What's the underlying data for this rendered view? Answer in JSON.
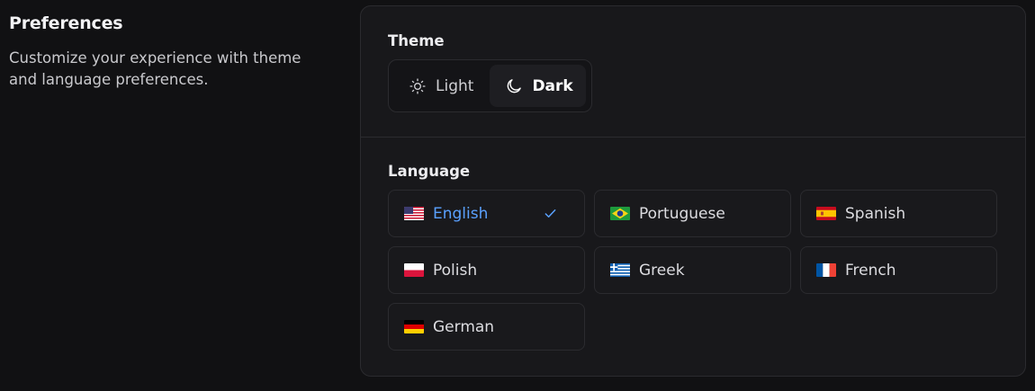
{
  "intro": {
    "title": "Preferences",
    "description": "Customize your experience with theme and language preferences."
  },
  "theme": {
    "label": "Theme",
    "selected": "Dark",
    "options": [
      {
        "label": "Light",
        "icon": "sun-icon"
      },
      {
        "label": "Dark",
        "icon": "moon-icon"
      }
    ]
  },
  "language": {
    "label": "Language",
    "selected": "English",
    "options": [
      {
        "label": "English",
        "flag": "us-flag-icon"
      },
      {
        "label": "Portuguese",
        "flag": "brazil-flag-icon"
      },
      {
        "label": "Spanish",
        "flag": "spain-flag-icon"
      },
      {
        "label": "Polish",
        "flag": "poland-flag-icon"
      },
      {
        "label": "Greek",
        "flag": "greece-flag-icon"
      },
      {
        "label": "French",
        "flag": "france-flag-icon"
      },
      {
        "label": "German",
        "flag": "germany-flag-icon"
      }
    ]
  },
  "colors": {
    "background": "#111113",
    "card": "#18181b",
    "border": "#2b2b2f",
    "accent": "#5aa1ff",
    "text": "#e6e6e8"
  }
}
